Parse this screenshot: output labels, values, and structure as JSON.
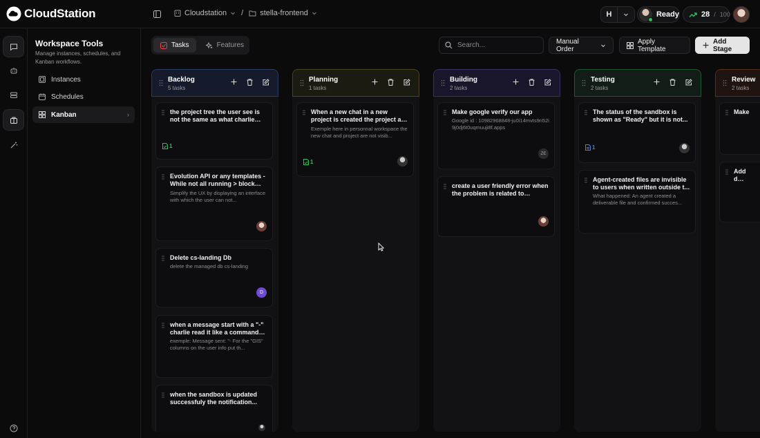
{
  "app": {
    "name": "CloudStation"
  },
  "breadcrumb": {
    "workspace": "Cloudstation",
    "project": "stella-frontend"
  },
  "topbar": {
    "h_label": "H",
    "status": "Ready",
    "credits_used": "28",
    "credits_sep": "/",
    "credits_total": "100"
  },
  "sidebar": {
    "title": "Workspace Tools",
    "subtitle": "Manage instances, schedules, and Kanban workflows.",
    "items": [
      {
        "label": "Instances",
        "icon": "server-icon"
      },
      {
        "label": "Schedules",
        "icon": "calendar-icon"
      },
      {
        "label": "Kanban",
        "icon": "grid-icon",
        "active": true
      }
    ]
  },
  "tabs": [
    {
      "label": "Tasks",
      "active": true
    },
    {
      "label": "Features",
      "active": false
    }
  ],
  "toolbar": {
    "search_placeholder": "Search...",
    "order_label": "Manual Order",
    "template_label": "Apply Template",
    "add_stage_label": "Add Stage"
  },
  "colors": {
    "backlog": "#2a3b67",
    "planning": "#4a4520",
    "building": "#3b2d66",
    "testing": "#1f5a34",
    "review": "#5a2e22",
    "green": "#22c55e",
    "blue": "#3b82f6",
    "purple": "#6d4bd8"
  },
  "columns": [
    {
      "name": "Backlog",
      "count": "5 tasks",
      "cards": [
        {
          "title": "the project tree the user see is not the same as what charlie see...",
          "desc": "",
          "badge": "1",
          "badge_icon": "file-green-icon"
        },
        {
          "title": "Evolution API or any templates - While not all running > block an...",
          "desc": "Simplify the UX by displaying an interface with which the user can not..."
        },
        {
          "title": "Delete cs-landing Db",
          "desc": "delete the managed db cs-landing",
          "avatar_letter": "D"
        },
        {
          "title": "when a message start with a \"-\" charlie read it like a command o...",
          "desc": "exemple: Message sent: \"- For the \"GIS\" columns on the user info put th..."
        },
        {
          "title": "when the sandbox is updated successfuly the notification...",
          "desc": ""
        }
      ]
    },
    {
      "name": "Planning",
      "count": "1 tasks",
      "cards": [
        {
          "title": "When a new chat in a new project is created the project and the...",
          "desc": "Exemple here in personnal workspace the new chat and project are not visib...",
          "badge": "1"
        }
      ]
    },
    {
      "name": "Building",
      "count": "2 tasks",
      "cards": [
        {
          "title": "Make google verify our app",
          "desc": "Google id : 10982968848-ju0i14mvts9n52i9j0dj6t0uqmuuji8f.apps",
          "avatar_letter": "ZE"
        },
        {
          "title": "create a user friendly error when the problem is related to claude...",
          "desc": ""
        }
      ]
    },
    {
      "name": "Testing",
      "count": "2 tasks",
      "cards": [
        {
          "title": "The status of the sandbox is shown as \"Ready\" but it is not...",
          "desc": "",
          "badge": "1"
        },
        {
          "title": "Agent-created files are invisible to users when written outside t...",
          "desc": "What happened: An agent created a deliverable file and confirmed succes..."
        }
      ]
    },
    {
      "name": "Review",
      "count": "2 tasks",
      "cards": [
        {
          "title": "Make",
          "desc": ""
        },
        {
          "title": "Add d auto f",
          "desc": ""
        }
      ]
    }
  ]
}
